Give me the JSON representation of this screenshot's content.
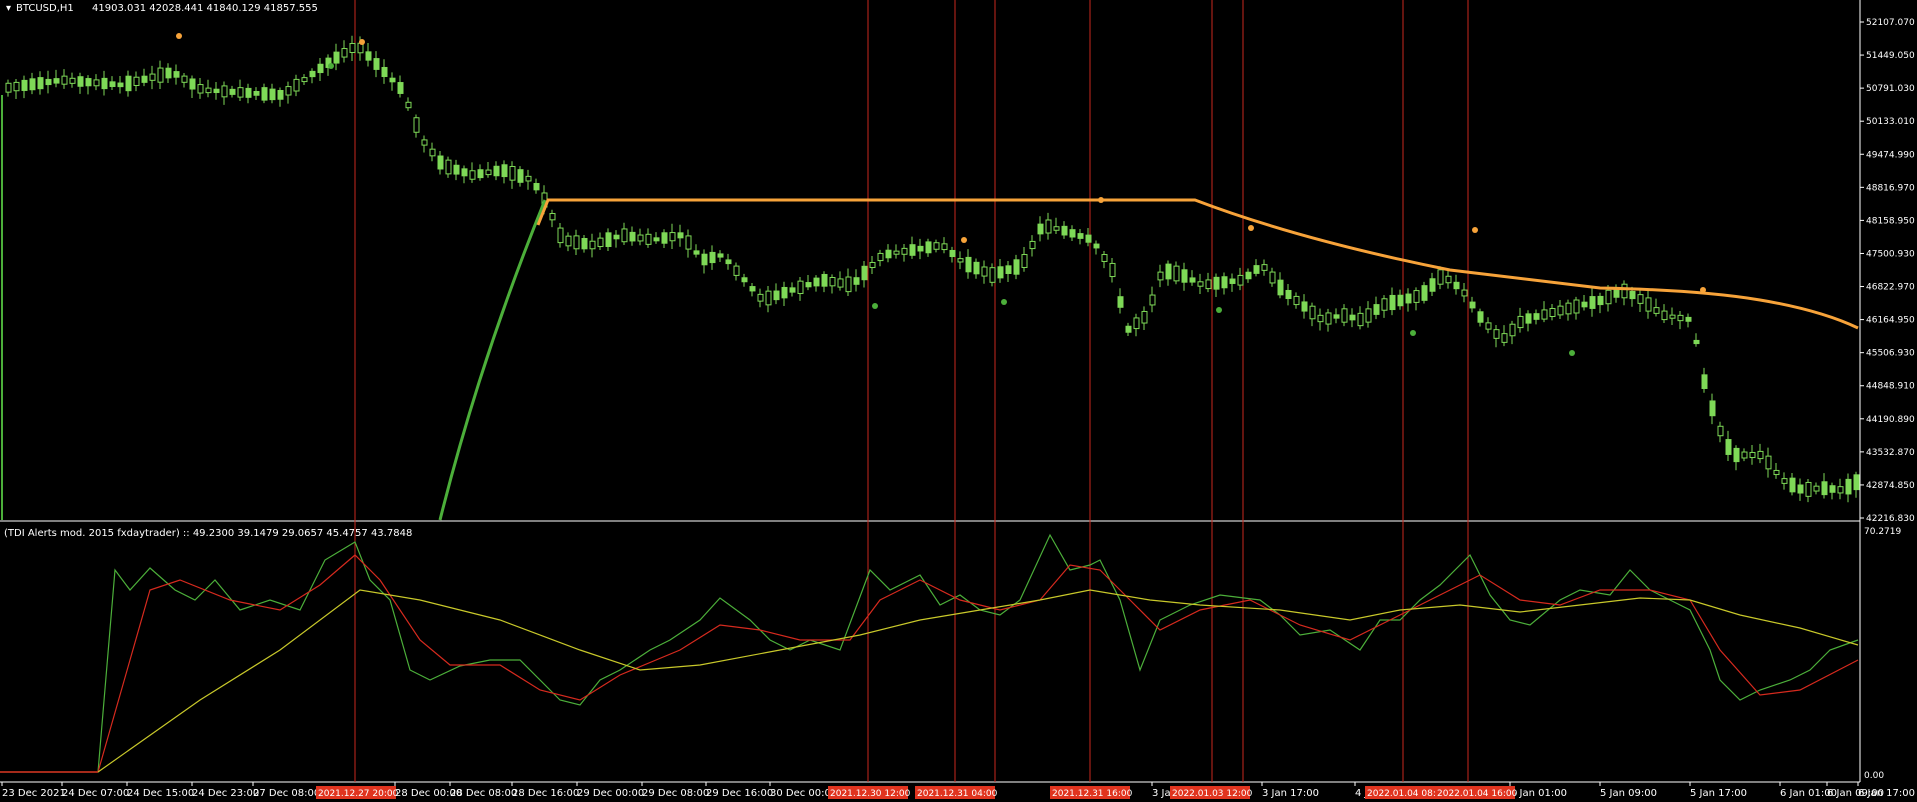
{
  "header": {
    "symbol_label": "BTCUSD,H1",
    "ohlc_label": "41903.031 42028.441 41840.129 41857.555"
  },
  "subwindow": {
    "title": "(TDI Alerts mod. 2015 fxdaytrader) ::  49.2300 39.1479 29.0657 45.4757 43.7848",
    "scale_top": "70.2719",
    "scale_bottom": "0.00"
  },
  "price_axis": {
    "labels": [
      "52107.070",
      "51449.050",
      "50791.030",
      "50133.010",
      "49474.990",
      "48816.970",
      "48158.950",
      "47500.930",
      "46822.970",
      "46164.950",
      "45506.930",
      "44848.910",
      "44190.890",
      "43532.870",
      "42874.850",
      "42216.830"
    ],
    "min": 42216.83,
    "max": 52107.07
  },
  "time_axis": {
    "labels": [
      "23 Dec 2021",
      "24 Dec 07:00",
      "24 Dec 15:00",
      "24 Dec 23:00",
      "27 Dec 08:00",
      "28 Dec 00:00",
      "28 Dec 08:00",
      "28 Dec 16:00",
      "29 Dec 00:00",
      "29 Dec 08:00",
      "29 Dec 16:00",
      "30 Dec 00:00",
      "3 Jan",
      "3 Jan 17:00",
      "4 Ja",
      "5 Jan 01:00",
      "5 Jan 09:00",
      "5 Jan 17:00",
      "6 Jan 01:00",
      "6 Jan 09:00",
      "6 Jan 17:00"
    ]
  },
  "event_markers": [
    "2021.12.27 20:00",
    "2021.12.30 12:00",
    "2021.12.31 04:00",
    "2021.12.31 16:00",
    "2022.01.03 12:00",
    "2022.01.04 08:00",
    "2022.01.04 16:00"
  ],
  "colors": {
    "background": "#000000",
    "candle": "#7ed957",
    "ma_line": "#f7a33a",
    "green_line": "#4caf3a",
    "red_line": "#d62a1e",
    "yellow_line": "#c8c82a",
    "vline": "#c8281e",
    "axis_text": "#ffffff",
    "marker_bg": "#e0341f"
  }
}
